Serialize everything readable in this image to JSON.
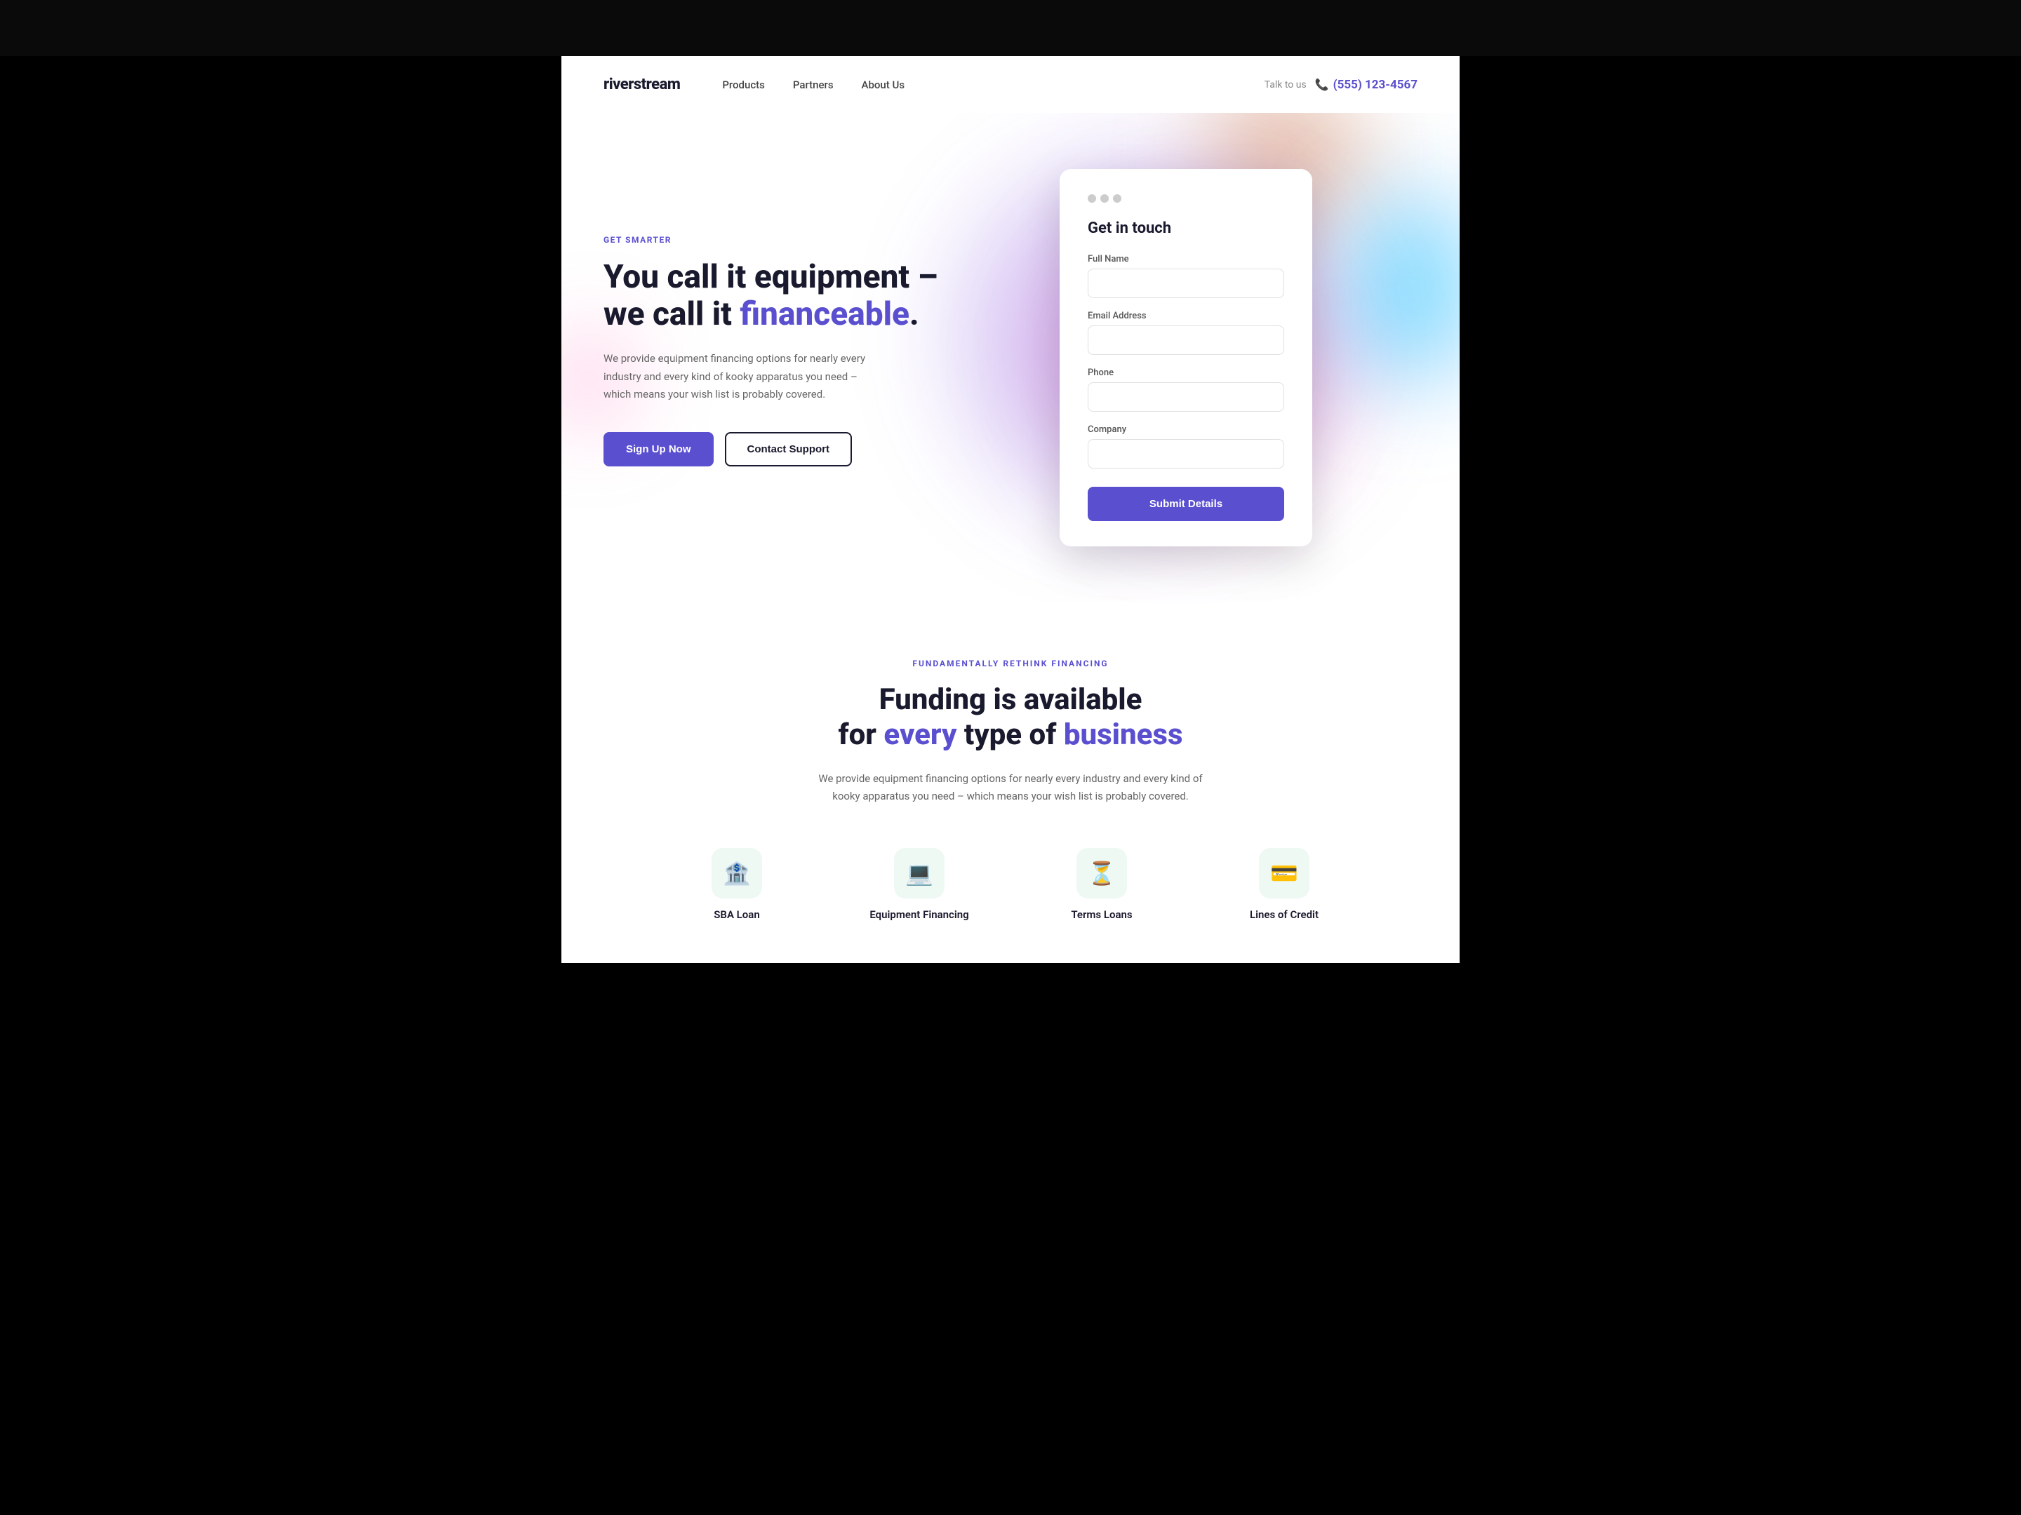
{
  "topBar": {},
  "nav": {
    "logo": "riverstream",
    "links": [
      {
        "label": "Products",
        "href": "#"
      },
      {
        "label": "Partners",
        "href": "#"
      },
      {
        "label": "About Us",
        "href": "#"
      }
    ],
    "talkLabel": "Talk to us",
    "phone": "(555) 123-4567"
  },
  "hero": {
    "eyebrow": "GET SMARTER",
    "titlePart1": "You call it equipment –",
    "titlePart2": "we call it ",
    "titleHighlight": "financeable",
    "titleEnd": ".",
    "description": "We provide equipment financing options for nearly every industry and every kind of kooky apparatus you need – which means your wish list is probably covered.",
    "btnPrimary": "Sign Up Now",
    "btnSecondary": "Contact Support"
  },
  "contactForm": {
    "title": "Get in touch",
    "fields": [
      {
        "label": "Full Name",
        "placeholder": ""
      },
      {
        "label": "Email Address",
        "placeholder": ""
      },
      {
        "label": "Phone",
        "placeholder": ""
      },
      {
        "label": "Company",
        "placeholder": ""
      }
    ],
    "submitLabel": "Submit Details"
  },
  "fundingSection": {
    "eyebrow": "FUNDAMENTALLY RETHINK FINANCING",
    "titlePart1": "Funding is available",
    "titlePart2": "for ",
    "titleHighlight1": "every",
    "titleMid": " type of ",
    "titleHighlight2": "business",
    "description": "We provide equipment financing options for nearly every industry and every kind of kooky apparatus you need – which means your wish list is probably covered.",
    "items": [
      {
        "icon": "🏦",
        "label": "SBA Loan"
      },
      {
        "icon": "💻",
        "label": "Equipment Financing"
      },
      {
        "icon": "⏳",
        "label": "Terms Loans"
      },
      {
        "icon": "💳",
        "label": "Lines of Credit"
      }
    ]
  }
}
